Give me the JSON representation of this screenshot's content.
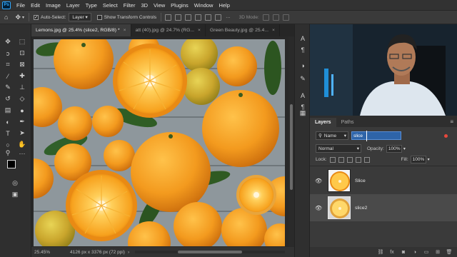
{
  "app": {
    "logo": "Ps"
  },
  "menu": [
    "File",
    "Edit",
    "Image",
    "Layer",
    "Type",
    "Select",
    "Filter",
    "3D",
    "View",
    "Plugins",
    "Window",
    "Help"
  ],
  "options": {
    "auto_select_label": "Auto-Select:",
    "auto_select_target": "Layer",
    "transform_controls_label": "Show Transform Controls",
    "mode_3d_label": "3D Mode:"
  },
  "tabs": [
    {
      "label": "Lemons.jpg @ 25.4% (slice2, RGB/8) *",
      "active": true
    },
    {
      "label": "att (40).jpg @ 24.7% (RG...",
      "active": false
    },
    {
      "label": "Green Beauty.jpg @ 25.4...",
      "active": false
    }
  ],
  "status": {
    "zoom": "25.45%",
    "dimensions": "4126 px x 3376 px (72 ppi)"
  },
  "panel": {
    "tabs": [
      "Layers",
      "Paths"
    ],
    "filter_kind": "Name",
    "search_value": "slice",
    "blend_mode": "Normal",
    "opacity_label": "Opacity:",
    "opacity_value": "100%",
    "lock_label": "Lock:",
    "fill_label": "Fill:",
    "fill_value": "100%"
  },
  "layers": [
    {
      "name": "Slice",
      "selected": false
    },
    {
      "name": "slice2",
      "selected": true
    }
  ],
  "colors": {
    "accent": "#31a8ff",
    "search_bg": "#2e64a8",
    "orange": "#f39a1e"
  },
  "icons": [
    "move-tool-icon",
    "marquee-icon",
    "lasso-icon",
    "crop-icon",
    "eyedropper-icon",
    "brush-icon",
    "eraser-icon",
    "text-tool-icon",
    "zoom-icon",
    "hand-icon",
    "eye-icon",
    "link-icon",
    "fx-icon",
    "mask-icon",
    "folder-icon",
    "trash-icon"
  ]
}
